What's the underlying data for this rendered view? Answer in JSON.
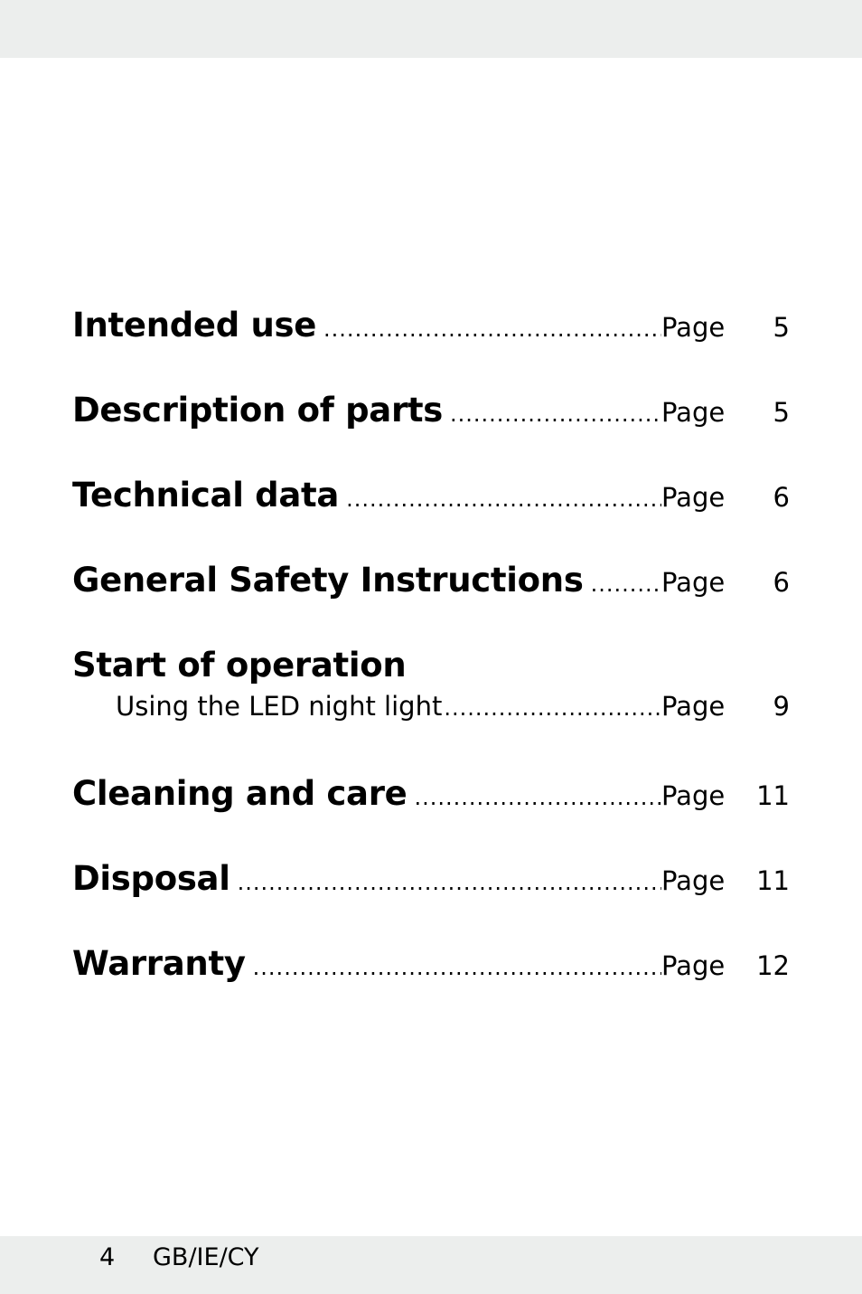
{
  "toc": {
    "entries": [
      {
        "title": "Intended use",
        "page_label": "Page",
        "page": "5"
      },
      {
        "title": "Description of parts",
        "page_label": "Page",
        "page": "5"
      },
      {
        "title": "Technical data",
        "page_label": "Page",
        "page": "6"
      },
      {
        "title": "General Safety Instructions",
        "page_label": "Page",
        "page": "6"
      },
      {
        "title": "Start of operation",
        "subentries": [
          {
            "title": "Using the LED night light",
            "page_label": "Page",
            "page": "9"
          }
        ]
      },
      {
        "title": "Cleaning and care",
        "page_label": "Page",
        "page": "11"
      },
      {
        "title": "Disposal",
        "page_label": "Page",
        "page": "11"
      },
      {
        "title": "Warranty",
        "page_label": "Page",
        "page": "12"
      }
    ],
    "leader": "............................................................................................................................"
  },
  "footer": {
    "page_number": "4",
    "language_codes": "GB/IE/CY"
  }
}
